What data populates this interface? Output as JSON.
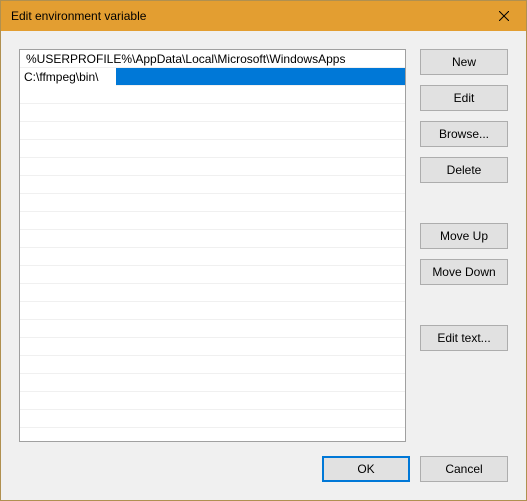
{
  "window": {
    "title": "Edit environment variable"
  },
  "list": {
    "items": [
      "%USERPROFILE%\\AppData\\Local\\Microsoft\\WindowsApps"
    ],
    "editing_value": "C:\\ffmpeg\\bin\\"
  },
  "buttons": {
    "new": "New",
    "edit": "Edit",
    "browse": "Browse...",
    "delete": "Delete",
    "move_up": "Move Up",
    "move_down": "Move Down",
    "edit_text": "Edit text...",
    "ok": "OK",
    "cancel": "Cancel"
  }
}
